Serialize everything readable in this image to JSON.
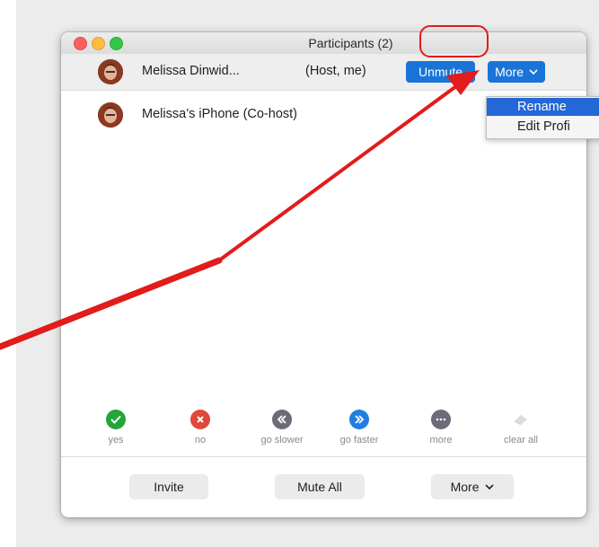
{
  "window": {
    "title": "Participants (2)"
  },
  "participants": [
    {
      "name": "Melissa Dinwid...",
      "role": "(Host, me)",
      "unmute_label": "Unmute",
      "more_label": "More"
    },
    {
      "name": "Melissa’s iPhone (Co-host)"
    }
  ],
  "more_menu": {
    "items": [
      {
        "label": "Rename",
        "selected": true
      },
      {
        "label": "Edit Profi",
        "selected": false
      }
    ]
  },
  "reactions": [
    {
      "label": "yes",
      "icon": "checkmark-icon",
      "color": "#23a53a"
    },
    {
      "label": "no",
      "icon": "x-icon",
      "color": "#e0483a"
    },
    {
      "label": "go slower",
      "icon": "rewind-icon",
      "color": "#6b6b7a"
    },
    {
      "label": "go faster",
      "icon": "fast-forward-icon",
      "color": "#1f7fe0"
    },
    {
      "label": "more",
      "icon": "ellipsis-icon",
      "color": "#6b6b7a"
    },
    {
      "label": "clear all",
      "icon": "eraser-icon",
      "color": "#d8d8d8"
    }
  ],
  "footer": {
    "invite_label": "Invite",
    "mute_all_label": "Mute All",
    "more_label": "More"
  },
  "colors": {
    "accent_blue": "#1a74d8",
    "annotation_red": "#e21b1b"
  }
}
